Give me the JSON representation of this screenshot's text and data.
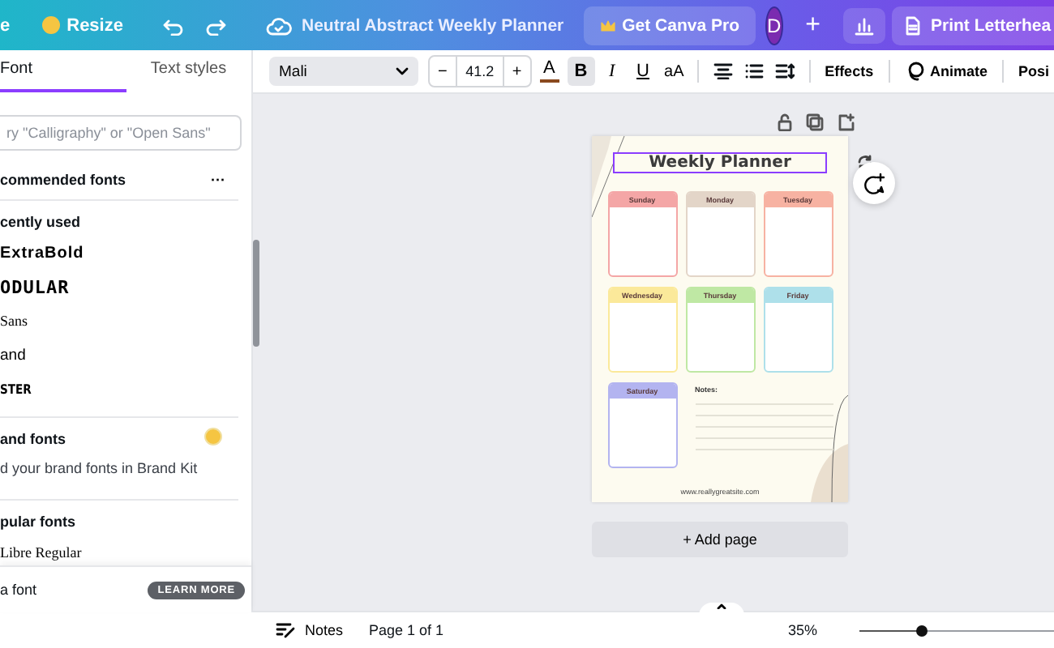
{
  "top_bar": {
    "home_label": "e",
    "resize_label": "Resize",
    "title": "Neutral Abstract Weekly Planner",
    "pro_button": "Get Canva Pro",
    "avatar": "D",
    "add": "+",
    "print_button": "Print Letterhea"
  },
  "toolbar": {
    "font": "Mali",
    "size_minus": "−",
    "font_size": "41.2",
    "size_plus": "+",
    "color_letter": "A",
    "bold": {
      "label": "B",
      "selected": true
    },
    "italic": {
      "label": "I",
      "selected": false
    },
    "underline": {
      "label": "U",
      "selected": false
    },
    "case": "aA",
    "effects": "Effects",
    "animate": "Animate",
    "position": "Posi"
  },
  "panel": {
    "tabs": [
      {
        "label": "Font",
        "selected": true
      },
      {
        "label": "Text styles",
        "selected": false
      }
    ],
    "search": {
      "placeholder": "ry \"Calligraphy\" or \"Open Sans\""
    },
    "recommended": {
      "title": "commended fonts",
      "more": "···"
    },
    "recent_title": "cently used",
    "recent_fonts": [
      {
        "label": "ExtraBold",
        "kind": "heavy"
      },
      {
        "label": "ODULAR",
        "kind": "display"
      },
      {
        "label": "Sans",
        "kind": "serif"
      },
      {
        "label": "and",
        "kind": "plain"
      },
      {
        "label": "STER",
        "kind": "condensed"
      }
    ],
    "brand": {
      "title": "and fonts",
      "hint": "d your brand fonts in Brand Kit"
    },
    "popular": {
      "title": "pular fonts",
      "fonts": [
        {
          "label": "Libre Regular",
          "kind": "serif"
        }
      ]
    },
    "footer": {
      "label": "a font",
      "badge": "LEARN MORE"
    }
  },
  "planner": {
    "title": "Weekly Planner",
    "days": [
      {
        "name": "Sunday",
        "color": "#f4a6a6"
      },
      {
        "name": "Monday",
        "color": "#e3d5c8"
      },
      {
        "name": "Tuesday",
        "color": "#f7b2a2"
      },
      {
        "name": "Wednesday",
        "color": "#fbe99a"
      },
      {
        "name": "Thursday",
        "color": "#bfe8a4"
      },
      {
        "name": "Friday",
        "color": "#aee0ea"
      },
      {
        "name": "Saturday",
        "color": "#b3b4f0"
      }
    ],
    "notes_label": "Notes:",
    "website": "www.reallygreatsite.com"
  },
  "add_page": "+ Add page",
  "bottom_bar": {
    "notes": "Notes",
    "page": "Page 1 of 1",
    "zoom": "35%",
    "zoom_slider": {
      "level": 0.32
    }
  }
}
